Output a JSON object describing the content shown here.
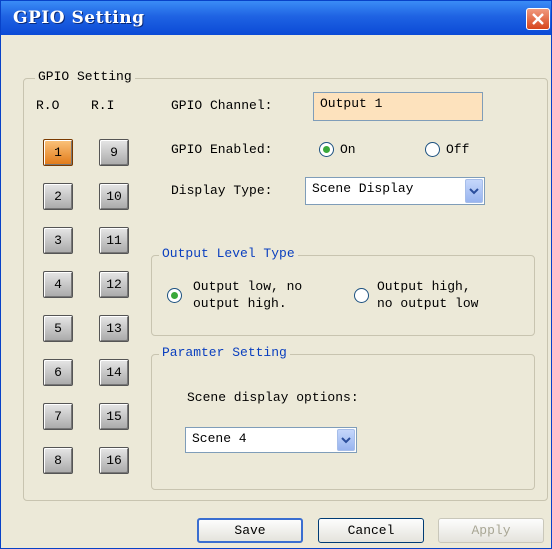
{
  "window": {
    "title": "GPIO Setting"
  },
  "group": {
    "title": "GPIO Setting"
  },
  "columns": {
    "ro": "R.O",
    "ri": "R.I"
  },
  "outputs": [
    "1",
    "2",
    "3",
    "4",
    "5",
    "6",
    "7",
    "8"
  ],
  "inputs": [
    "9",
    "10",
    "11",
    "12",
    "13",
    "14",
    "15",
    "16"
  ],
  "channel": {
    "label": "GPIO Channel:",
    "value": "Output 1"
  },
  "enabled": {
    "label": "GPIO Enabled:",
    "on": "On",
    "off": "Off",
    "selected": "On"
  },
  "display": {
    "label": "Display Type:",
    "value": "Scene Display"
  },
  "output_level": {
    "title": "Output Level Type",
    "opt1_line1": "Output low, no",
    "opt1_line2": "output high.",
    "opt2_line1": "Output high,",
    "opt2_line2": "no output low",
    "selected": "opt1"
  },
  "param": {
    "title": "Paramter Setting",
    "label": "Scene display options:",
    "value": "Scene 4"
  },
  "buttons": {
    "save": "Save",
    "cancel": "Cancel",
    "apply": "Apply"
  },
  "colors": {
    "title_bar": "#1f63e3",
    "channel_bg": "#fde2bd",
    "active_button": "#f0a040"
  }
}
